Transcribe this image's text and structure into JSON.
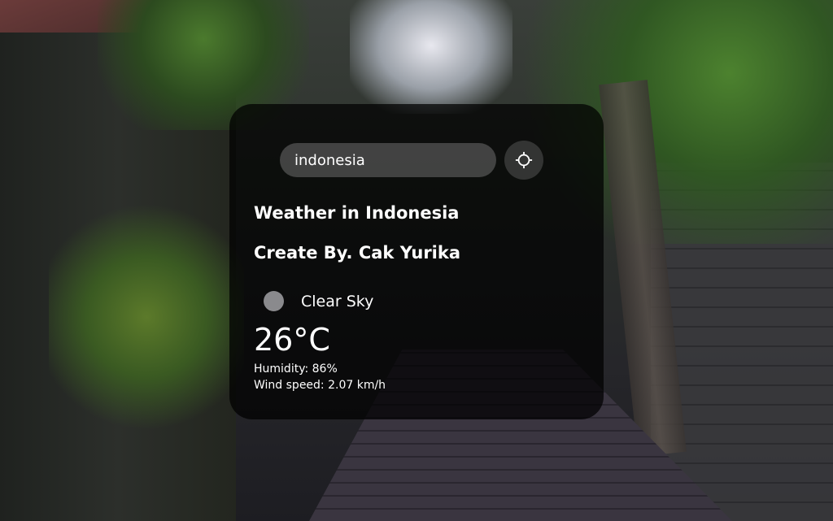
{
  "search": {
    "value": "indonesia",
    "locate_icon": "crosshair-icon"
  },
  "weather": {
    "title": "Weather in Indonesia",
    "author": "Create By. Cak Yurika",
    "condition": "Clear Sky",
    "condition_icon": "weather-condition-icon",
    "temperature": "26°C",
    "humidity": "Humidity: 86%",
    "wind": "Wind speed: 2.07 km/h"
  },
  "colors": {
    "card_background": "#000000",
    "text": "#ffffff"
  }
}
